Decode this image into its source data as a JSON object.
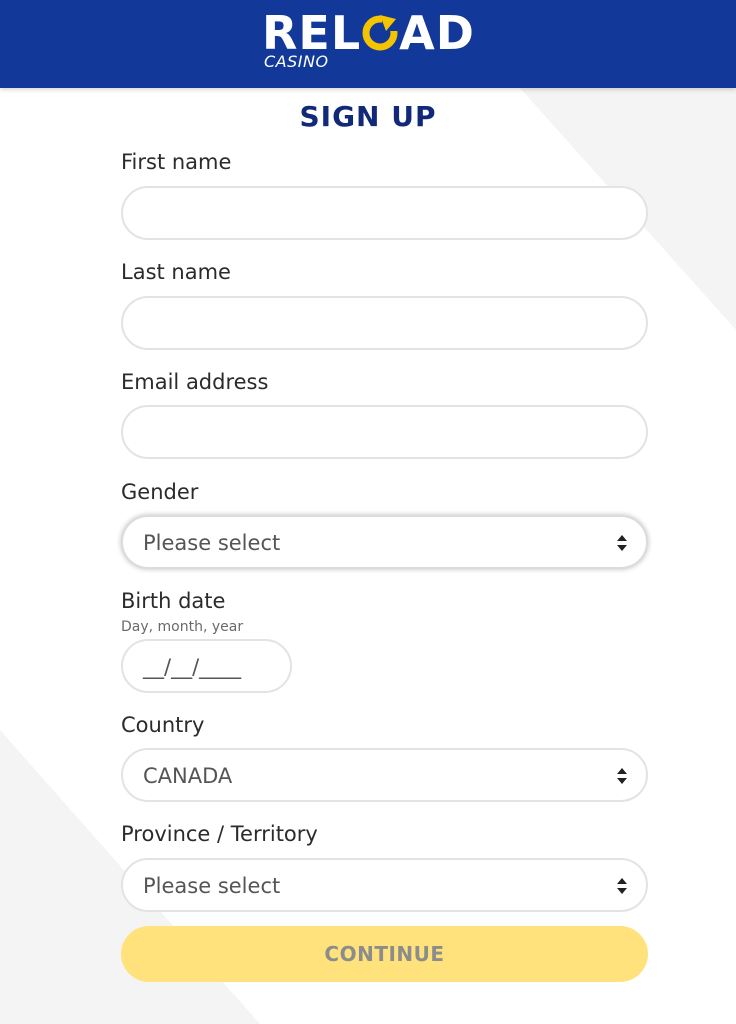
{
  "header": {
    "logo_text_left": "REL",
    "logo_text_right": "AD",
    "logo_subtitle": "CASINO",
    "background_color": "#12399a"
  },
  "page_title": "SIGN UP",
  "form": {
    "first_name": {
      "label": "First name",
      "value": ""
    },
    "last_name": {
      "label": "Last name",
      "value": ""
    },
    "email": {
      "label": "Email address",
      "value": ""
    },
    "gender": {
      "label": "Gender",
      "selected": "Please select",
      "icon": "sort-icon"
    },
    "birth_date": {
      "label": "Birth date",
      "hint": "Day, month, year",
      "mask": "__/__/____"
    },
    "country": {
      "label": "Country",
      "selected": "CANADA",
      "icon": "sort-icon"
    },
    "province": {
      "label": "Province / Territory",
      "selected": "Please select",
      "icon": "sort-icon"
    },
    "continue_label": "CONTINUE"
  },
  "colors": {
    "brand_blue": "#12399a",
    "title_navy": "#12297a",
    "logo_accent_yellow": "#f5c400",
    "button_yellow": "#ffe27c"
  }
}
